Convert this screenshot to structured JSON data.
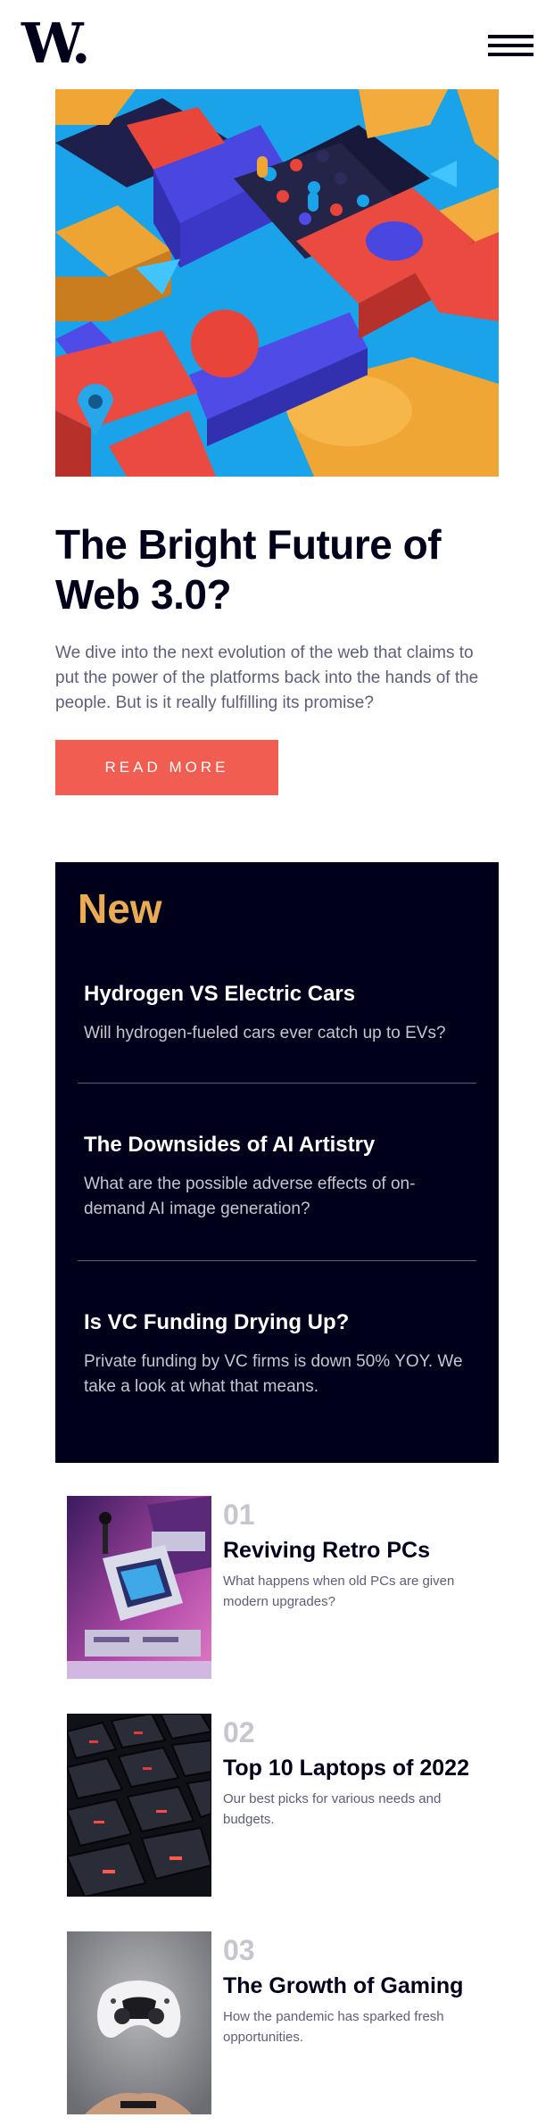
{
  "header": {
    "logo_text": "W."
  },
  "hero": {
    "title": "The Bright Future of Web 3.0?",
    "description": "We dive into the next evolution of the web that claims to put the power of the platforms back into the hands of the people. But is it really fulfilling its promise?",
    "button_label": "READ MORE"
  },
  "new_section": {
    "heading": "New",
    "items": [
      {
        "title": "Hydrogen VS Electric Cars",
        "description": "Will hydrogen-fueled cars ever catch up to EVs?"
      },
      {
        "title": "The Downsides of AI Artistry",
        "description": "What are the possible adverse effects of on-demand AI image generation?"
      },
      {
        "title": "Is VC Funding Drying Up?",
        "description": "Private funding by VC firms is down 50% YOY. We take a look at what that means."
      }
    ]
  },
  "trending": [
    {
      "number": "01",
      "title": "Reviving Retro PCs",
      "description": "What happens when old PCs are given modern upgrades?"
    },
    {
      "number": "02",
      "title": "Top 10 Laptops of 2022",
      "description": "Our best picks for various needs and budgets."
    },
    {
      "number": "03",
      "title": "The Growth of Gaming",
      "description": "How the pandemic has sparked fresh opportunities."
    }
  ],
  "colors": {
    "off_white": "#fffdfa",
    "soft_orange": "#e9ab53",
    "soft_red": "#f15d51",
    "very_dark_blue": "#00001a",
    "grayish_blue": "#5d5f79",
    "dark_grayish_blue": "#c5c6ce"
  },
  "icons": {
    "menu": "hamburger-menu-icon"
  }
}
